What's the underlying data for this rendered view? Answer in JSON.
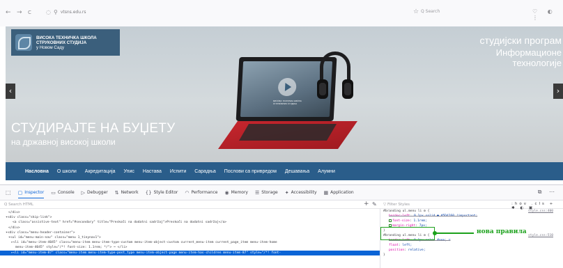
{
  "browser": {
    "back": "←",
    "forward": "→",
    "reload": "C",
    "url": "vtsns.edu.rs",
    "search_placeholder": "Q Search",
    "right_icons": "♡ ◐ ⋮"
  },
  "site": {
    "logo_lines": [
      "ВИСОКА ТЕХНИЧКА ШКОЛА",
      "СТРУКОВНИХ СТУДИЈА"
    ],
    "logo_city": "у Новом Саду",
    "program_line1": "студијски програм",
    "program_line2": "Информационе технологије",
    "slogan_line1": "СТУДИРАЈТЕ НА БУЏЕТУ",
    "slogan_line2": "на државној високој школи",
    "laptop_screen_text": "ВИСОКА ТЕХНИЧКА ШКОЛА СТРУКОВНИХ СТУДИЈА",
    "menu": [
      {
        "label": "Насловна",
        "active": true
      },
      {
        "label": "О школи",
        "active": false
      },
      {
        "label": "Акредитација",
        "active": false
      },
      {
        "label": "Упис",
        "active": false
      },
      {
        "label": "Настава",
        "active": false
      },
      {
        "label": "Испити",
        "active": false
      },
      {
        "label": "Сарадња",
        "active": false
      },
      {
        "label": "Послови са привредом",
        "active": false
      },
      {
        "label": "Дешавања",
        "active": false
      },
      {
        "label": "Алумни",
        "active": false
      }
    ]
  },
  "devtools": {
    "tabs": [
      {
        "label": "Inspector",
        "icon": "▢",
        "active": true
      },
      {
        "label": "Console",
        "icon": "▭",
        "active": false
      },
      {
        "label": "Debugger",
        "icon": "▷",
        "active": false
      },
      {
        "label": "Network",
        "icon": "⇅",
        "active": false
      },
      {
        "label": "Style Editor",
        "icon": "{}",
        "active": false
      },
      {
        "label": "Performance",
        "icon": "◠",
        "active": false
      },
      {
        "label": "Memory",
        "icon": "◉",
        "active": false
      },
      {
        "label": "Storage",
        "icon": "☰",
        "active": false
      },
      {
        "label": "Accessibility",
        "icon": "✦",
        "active": false
      },
      {
        "label": "Application",
        "icon": "▦",
        "active": false
      }
    ],
    "right_tools": "⧉ ⋯",
    "html_search_placeholder": "Q Search HTML",
    "styles_filter_placeholder": "▽ Filter Styles",
    "styles_tools": ":hov .cls + ✱ ◐ ▣",
    "markup_lines": [
      {
        "indent": 12,
        "text": "</div>",
        "selected": false
      },
      {
        "indent": 8,
        "text": "▾<div class=\"skip-link\">",
        "selected": false
      },
      {
        "indent": 18,
        "text": "<a class=\"assistive-text\" href=\"#secondary\" title=\"Preskoči na dodatni sadržaj\">Preskoči na dodatni sadržaj</a>",
        "selected": false
      },
      {
        "indent": 12,
        "text": "</div>",
        "selected": false
      },
      {
        "indent": 8,
        "text": "▾<div class=\"menu-header-container\">",
        "selected": false
      },
      {
        "indent": 12,
        "text": "▾<ul id=\"menu-main-nav\" class=\"menu 1_tinynav1\">",
        "selected": false
      },
      {
        "indent": 16,
        "text": "▸<li id=\"menu-item-4045\" class=\"menu-item menu-item-type-custom menu-item-object-custom current_menu-item current_page_item menu-item-home",
        "selected": false
      },
      {
        "indent": 22,
        "text": "menu-item-4045\" style=\"/*! font-size: 1.1rem; */\"> ⋯ </li>",
        "selected": false
      },
      {
        "indent": 16,
        "text": "▸<li id=\"menu-item-87\" class=\"menu-item menu-item-type-post_type menu-item-object-page menu-item-has-children menu-item-87\" style=\"/*! font-",
        "selected": true
      }
    ],
    "rules": [
      {
        "selector": "#branding ul.menu li ⚙ {",
        "source": "style.css:400",
        "declarations": [
          {
            "prop": "border-left",
            "value": "0.1px solid ● #5D4260 !important;",
            "struck": true,
            "checked": false
          },
          {
            "prop": "font-size",
            "value": "1.1rem;",
            "struck": false,
            "checked": true
          },
          {
            "prop": "margin-right",
            "value": "7px;",
            "struck": false,
            "checked": true
          }
        ]
      },
      {
        "selector": "#branding ul.menu li ⚙ {",
        "source": "style.css:510",
        "declarations": [
          {
            "prop": "border-left",
            "value": "0.1px solid #eee; ▽",
            "struck": true,
            "checked": false
          },
          {
            "prop": "float",
            "value": "left;",
            "struck": false,
            "checked": false
          },
          {
            "prop": "position",
            "value": "relative;",
            "struck": false,
            "checked": false
          }
        ]
      }
    ],
    "callout_label": "нова правила"
  },
  "colors": {
    "menu_bar": "#2a5d8a",
    "logo_bg": "#3b5f7c",
    "callout": "#1ba11b",
    "selection": "#0a64d6"
  }
}
